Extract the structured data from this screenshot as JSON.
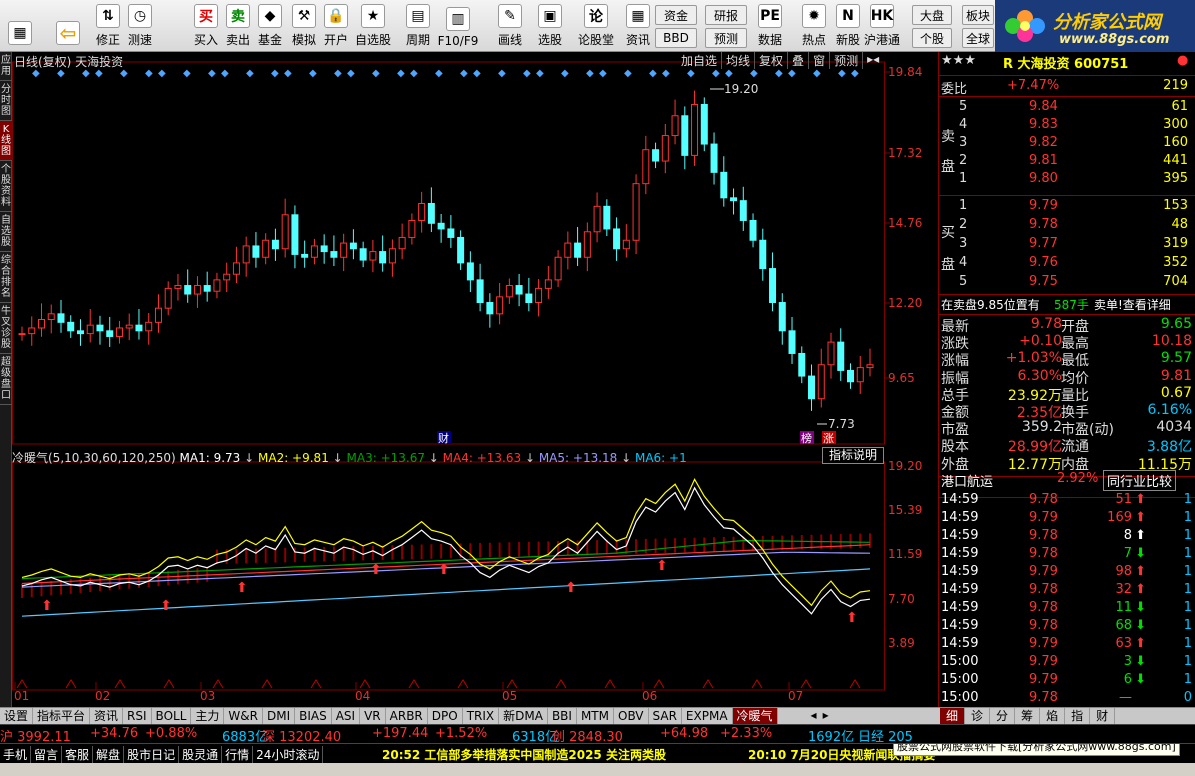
{
  "toolbar": {
    "buttons": [
      {
        "name": "windows-button",
        "label": "",
        "icon": "windows-icon"
      },
      {
        "name": "back-button",
        "label": "",
        "icon": "back-arrow-icon"
      },
      {
        "name": "fix-button",
        "label": "修正",
        "icon": "updown-arrows-icon"
      },
      {
        "name": "measure-button",
        "label": "测速",
        "icon": "clock-icon"
      },
      {
        "name": "buy-button",
        "label": "买入",
        "icon": "买"
      },
      {
        "name": "sell-button",
        "label": "卖出",
        "icon": "卖"
      },
      {
        "name": "fund-button",
        "label": "基金",
        "icon": "fund-icon"
      },
      {
        "name": "simulate-button",
        "label": "模拟",
        "icon": "hammer-icon"
      },
      {
        "name": "open-account-button",
        "label": "开户",
        "icon": "lock-icon"
      },
      {
        "name": "watchlist-button",
        "label": "自选股",
        "icon": "star-icon"
      },
      {
        "name": "period-button",
        "label": "周期",
        "icon": "calendar-icon"
      },
      {
        "name": "f10-button",
        "label": "F10/F9",
        "icon": "document-icon"
      },
      {
        "name": "draw-button",
        "label": "画线",
        "icon": "pencil-icon"
      },
      {
        "name": "pick-stock-button",
        "label": "选股",
        "icon": "screen-icon"
      },
      {
        "name": "forum-button",
        "label": "论股堂",
        "icon": "论"
      },
      {
        "name": "news-button",
        "label": "资讯",
        "icon": "news-icon"
      },
      {
        "name": "data-button",
        "label": "数据",
        "icon": "pe-icon"
      },
      {
        "name": "hot-button",
        "label": "热点",
        "icon": "fire-icon"
      },
      {
        "name": "new-stock-button",
        "label": "新股",
        "icon": "new-icon"
      },
      {
        "name": "hk-connect-button",
        "label": "沪港通",
        "icon": "hk-icon"
      }
    ],
    "small": [
      {
        "name": "capital-button",
        "label": "资金"
      },
      {
        "name": "bbd-button",
        "label": "BBD"
      },
      {
        "name": "research-button",
        "label": "研报"
      },
      {
        "name": "forecast-button",
        "label": "预测"
      },
      {
        "name": "market-button",
        "label": "大盘"
      },
      {
        "name": "stock-button",
        "label": "个股"
      },
      {
        "name": "sector-button",
        "label": "板块"
      },
      {
        "name": "global-button",
        "label": "全球"
      }
    ],
    "logo_text": "分析家公式网",
    "logo_url": "www.88gs.com"
  },
  "left_tabs": [
    "应用",
    "分时图",
    "K线图",
    "个股资料",
    "自选股",
    "综合排名",
    "牛叉诊股",
    "超级盘口"
  ],
  "chart": {
    "header_left": "日线(复权)  天海投资",
    "header_right": [
      "加自选",
      "均线",
      "复权",
      "叠",
      "窗",
      "预测"
    ],
    "price_ticks": [
      "19.84",
      "17.32",
      "14.76",
      "12.20",
      "9.65"
    ],
    "high_label": "19.20",
    "low_label": "7.73",
    "cai_label": "财",
    "bang_label": "榜",
    "zhang_label": "涨",
    "indicator_name": "冷暖气(5,10,30,60,120,250)",
    "ma1": "MA1: 9.73",
    "ma2": "MA2: +9.81",
    "ma3": "MA3: +13.67",
    "ma4": "MA4: +13.63",
    "ma5": "MA5: +13.18",
    "ma6": "MA6: +1",
    "indicator_help": "指标说明",
    "ind_ticks": [
      "19.20",
      "15.39",
      "11.59",
      "7.70",
      "3.89"
    ],
    "months": [
      "01",
      "02",
      "03",
      "04",
      "05",
      "06",
      "07"
    ]
  },
  "chart_data": {
    "type": "candlestick",
    "title": "日线(复权) 天海投资",
    "ylim": [
      7.0,
      20.5
    ],
    "high": 19.2,
    "low": 7.73,
    "last": 9.78,
    "months": [
      "01",
      "02",
      "03",
      "04",
      "05",
      "06",
      "07"
    ],
    "series": [
      {
        "name": "MA1",
        "value": 9.73
      },
      {
        "name": "MA2",
        "value": 9.81
      },
      {
        "name": "MA3",
        "value": 13.67
      },
      {
        "name": "MA4",
        "value": 13.63
      },
      {
        "name": "MA5",
        "value": 13.18
      }
    ]
  },
  "quote": {
    "stars": "★★★",
    "stock_title": "R 大海投资 600751",
    "weibi_label": "委比",
    "weibi_pct": "+7.47%",
    "weibi_val": "219",
    "sell_label": "卖\n盘",
    "buy_label": "买\n盘",
    "asks": [
      [
        "5",
        "9.84",
        "61"
      ],
      [
        "4",
        "9.83",
        "300"
      ],
      [
        "3",
        "9.82",
        "160"
      ],
      [
        "2",
        "9.81",
        "441"
      ],
      [
        "1",
        "9.80",
        "395"
      ]
    ],
    "bids": [
      [
        "1",
        "9.79",
        "153"
      ],
      [
        "2",
        "9.78",
        "48"
      ],
      [
        "3",
        "9.77",
        "319"
      ],
      [
        "4",
        "9.76",
        "352"
      ],
      [
        "5",
        "9.75",
        "704"
      ]
    ],
    "notice": "在卖盘9.85位置有",
    "notice_qty": "587手",
    "notice_link": "卖单!查看详细",
    "stats": [
      [
        "最新",
        "9.78",
        "开盘",
        "9.65"
      ],
      [
        "涨跌",
        "+0.10",
        "最高",
        "10.18"
      ],
      [
        "涨幅",
        "+1.03%",
        "最低",
        "9.57"
      ],
      [
        "振幅",
        "6.30%",
        "均价",
        "9.81"
      ],
      [
        "总手",
        "23.92万",
        "量比",
        "0.67"
      ],
      [
        "金额",
        "2.35亿",
        "换手",
        "6.16%"
      ],
      [
        "市盈",
        "359.2",
        "市盈(动)",
        "4034"
      ],
      [
        "股本",
        "28.99亿",
        "流通",
        "3.88亿"
      ],
      [
        "外盘",
        "12.77万",
        "内盘",
        "11.15万"
      ]
    ],
    "sector_name": "港口航运",
    "sector_pct": "2.92%",
    "sector_btn": "同行业比较",
    "ticks": [
      [
        "14:59",
        "9.78",
        "51",
        "up",
        "1"
      ],
      [
        "14:59",
        "9.79",
        "169",
        "up",
        "1"
      ],
      [
        "14:59",
        "9.78",
        "8",
        "flat",
        "1"
      ],
      [
        "14:59",
        "9.78",
        "7",
        "down",
        "1"
      ],
      [
        "14:59",
        "9.79",
        "98",
        "up",
        "1"
      ],
      [
        "14:59",
        "9.78",
        "32",
        "up",
        "1"
      ],
      [
        "14:59",
        "9.78",
        "11",
        "down",
        "1"
      ],
      [
        "14:59",
        "9.78",
        "68",
        "down",
        "1"
      ],
      [
        "14:59",
        "9.79",
        "63",
        "up",
        "1"
      ],
      [
        "15:00",
        "9.79",
        "3",
        "down",
        "1"
      ],
      [
        "15:00",
        "9.79",
        "6",
        "down",
        "1"
      ],
      [
        "15:00",
        "9.78",
        "—",
        "none",
        "0"
      ]
    ]
  },
  "bottom_tabs": [
    "设置",
    "指标平台",
    "资讯",
    "RSI",
    "BOLL",
    "主力",
    "W&R",
    "DMI",
    "BIAS",
    "ASI",
    "VR",
    "ARBR",
    "DPO",
    "TRIX",
    "新DMA",
    "BBI",
    "MTM",
    "OBV",
    "SAR",
    "EXPMA",
    "冷暖气"
  ],
  "right_tabs": [
    "细",
    "诊",
    "分",
    "筹",
    "焰",
    "指",
    "财"
  ],
  "status1": {
    "sh": "沪 3992.11",
    "sh_chg": "+34.76",
    "sh_pct": "+0.88%",
    "sh_amt": "6883亿",
    "sz": "深 13202.40",
    "sz_chg": "+197.44",
    "sz_pct": "+1.52%",
    "sz_amt": "6318亿",
    "cy": "创 2848.30",
    "cy_chg": "+64.98",
    "cy_pct": "+2.33%",
    "cy_amt": "1692亿",
    "rj": "日经 205"
  },
  "status2": {
    "items": [
      "手机",
      "留言",
      "客服",
      "解盘",
      "股市日记",
      "股灵通",
      "行情",
      "24小时滚动"
    ],
    "news1": "20:52 工信部多举措落实中国制造2025 关注两类股",
    "news2": "20:10 7月20日央视新闻联播摘要",
    "ad": "股票公式网股票软件下载[分析家公式网www.88gs.com]"
  }
}
